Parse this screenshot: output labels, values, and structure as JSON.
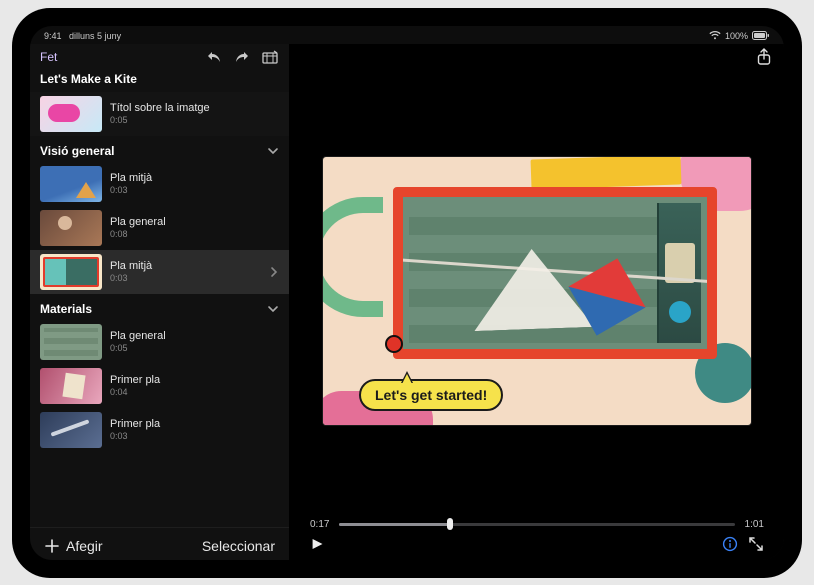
{
  "status": {
    "time": "9:41",
    "date": "dilluns 5 juny",
    "battery": "100%"
  },
  "toolbar": {
    "done_label": "Fet"
  },
  "project": {
    "title": "Let's Make a Kite",
    "hero_clip": {
      "label": "Títol sobre la imatge",
      "duration": "0:05"
    }
  },
  "sections": [
    {
      "title": "Visió general",
      "clips": [
        {
          "label": "Pla mitjà",
          "duration": "0:03",
          "thumb": "t-kite",
          "selected": false
        },
        {
          "label": "Pla general",
          "duration": "0:08",
          "thumb": "t-person",
          "selected": false
        },
        {
          "label": "Pla mitjà",
          "duration": "0:03",
          "thumb": "t-collage",
          "selected": true
        }
      ]
    },
    {
      "title": "Materials",
      "clips": [
        {
          "label": "Pla general",
          "duration": "0:05",
          "thumb": "t-board",
          "selected": false
        },
        {
          "label": "Primer pla",
          "duration": "0:04",
          "thumb": "t-craft",
          "selected": false
        },
        {
          "label": "Primer pla",
          "duration": "0:03",
          "thumb": "t-tools",
          "selected": false
        }
      ]
    }
  ],
  "sidebar_footer": {
    "add_label": "Afegir",
    "select_label": "Seleccionar"
  },
  "viewer": {
    "overlay_text": "Let's get started!",
    "time_current": "0:17",
    "time_total": "1:01"
  }
}
